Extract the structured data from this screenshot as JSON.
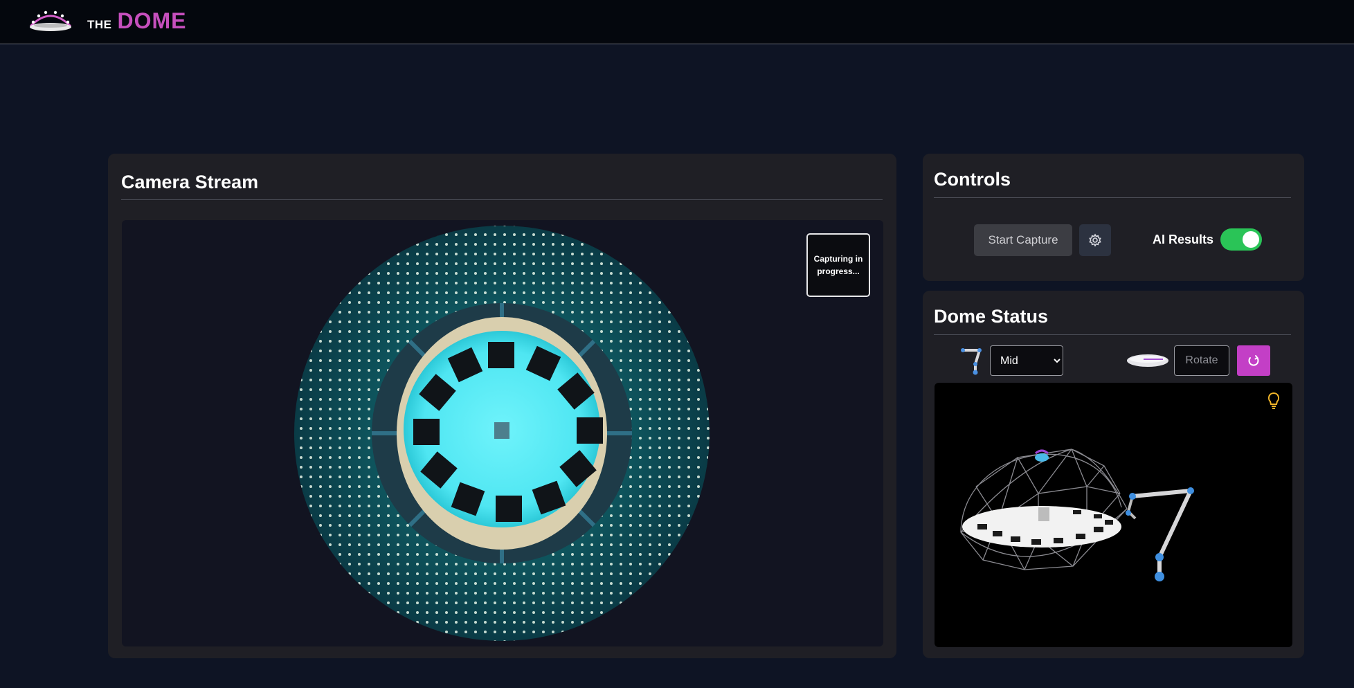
{
  "header": {
    "brand_prefix": "THE",
    "brand_name": "DOME"
  },
  "camera": {
    "title": "Camera Stream",
    "status_badge": "Capturing in progress..."
  },
  "controls": {
    "title": "Controls",
    "start_capture_label": "Start Capture",
    "ai_results_label": "AI Results",
    "ai_results_enabled": true
  },
  "dome_status": {
    "title": "Dome Status",
    "arm_position": {
      "selected": "Mid",
      "options": [
        "Mid"
      ]
    },
    "rotate_placeholder": "Rotate"
  },
  "colors": {
    "accent": "#c64fbd",
    "toggle_on": "#2ac457",
    "panel": "#1f1f25",
    "background": "#0e1424"
  },
  "icons": {
    "logo": "dome-logo-icon",
    "settings": "gear-icon",
    "arm": "robot-arm-icon",
    "turntable": "turntable-icon",
    "reset": "reset-icon",
    "light": "lightbulb-icon"
  }
}
